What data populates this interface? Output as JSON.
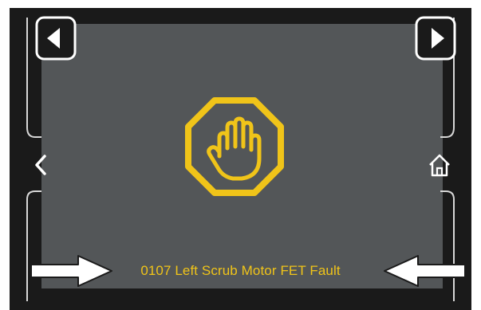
{
  "screen": {
    "fault_message": "0107 Left Scrub Motor FET Fault"
  },
  "buttons": {
    "prev_page": {
      "icon": "triangle-left-icon"
    },
    "next_page": {
      "icon": "triangle-right-icon"
    },
    "back": {
      "icon": "chevron-left-icon"
    },
    "home": {
      "icon": "home-icon"
    }
  },
  "icons": {
    "fault_icon": "stop-hand-octagon-icon",
    "left_pointer": "arrow-right-icon",
    "right_pointer": "arrow-left-icon"
  },
  "colors": {
    "background": "#535658",
    "bezel": "#1a1a1a",
    "accent": "#f0c419",
    "callout_arrow": "#ffffff"
  }
}
